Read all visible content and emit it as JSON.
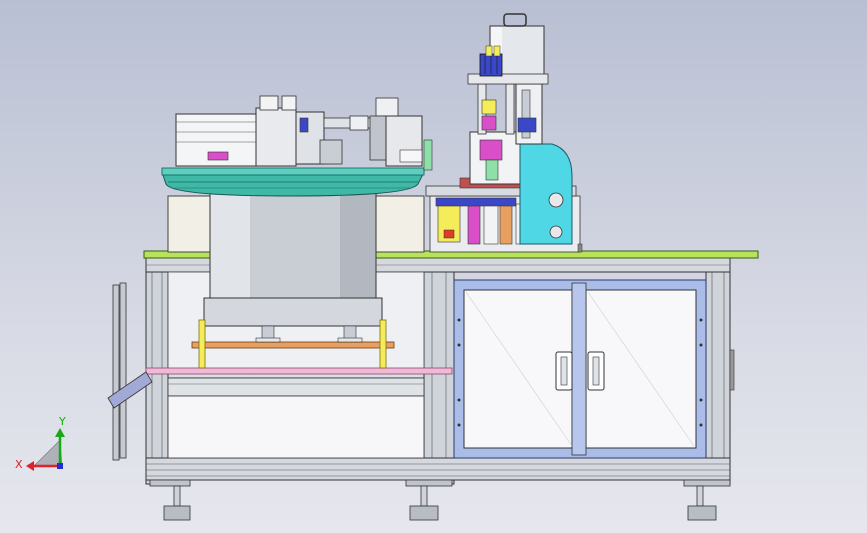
{
  "triad": {
    "x_label": "X",
    "y_label": "Y",
    "x_color": "#e0202a",
    "y_color": "#18a818",
    "z_color": "#2030d0"
  },
  "colors": {
    "frame": "#c7ccd4",
    "top_plate": "#b7e35b",
    "bowl": "#3fb8a8",
    "pink_rail": "#f2b8d8",
    "orange_bar": "#e8a060",
    "yellow_post": "#f5ec5a",
    "door_panel": "#a9bde8",
    "cyan_bracket": "#4fd7e6"
  }
}
